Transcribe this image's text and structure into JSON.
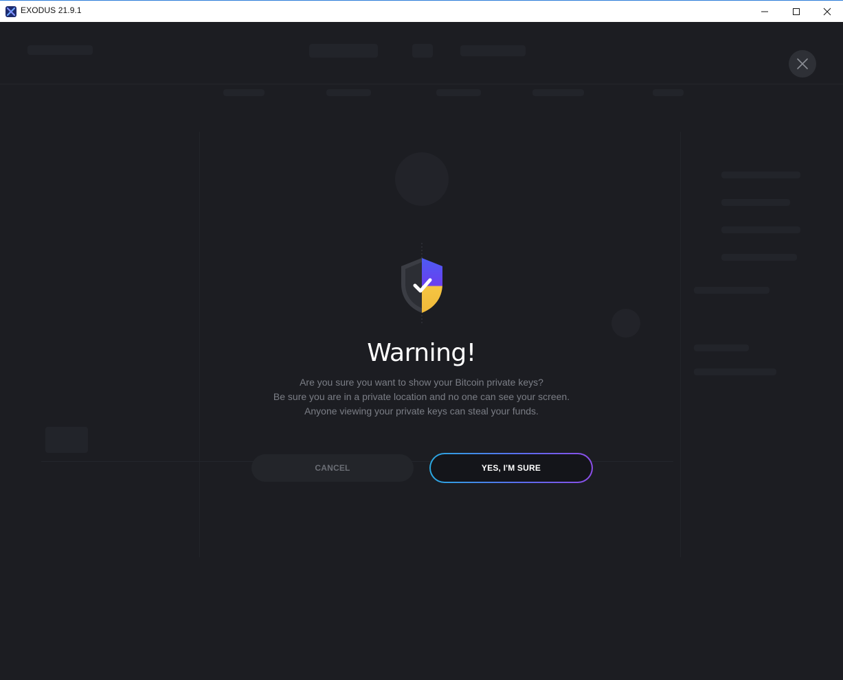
{
  "window": {
    "title": "EXODUS 21.9.1",
    "icon": "exodus-logo-icon",
    "controls": [
      "minimize-icon",
      "maximize-icon",
      "close-icon"
    ]
  },
  "modal": {
    "close_icon": "close-icon",
    "illustration": "shield-check-icon",
    "title": "Warning!",
    "lines": [
      "Are you sure you want to show your Bitcoin private keys?",
      "Be sure you are in a private location and no one can see your screen.",
      "Anyone viewing your private keys can steal your funds."
    ],
    "cancel_label": "CANCEL",
    "confirm_label": "YES, I'M SURE"
  },
  "colors": {
    "background": "#1b1c20",
    "title_text": "#ffffff",
    "body_text": "#7b7e86",
    "confirm_gradient_start": "#2aa8e0",
    "confirm_gradient_end": "#8c4ee8",
    "shield_purple": "#5b3ff0",
    "shield_yellow": "#f5c542"
  }
}
